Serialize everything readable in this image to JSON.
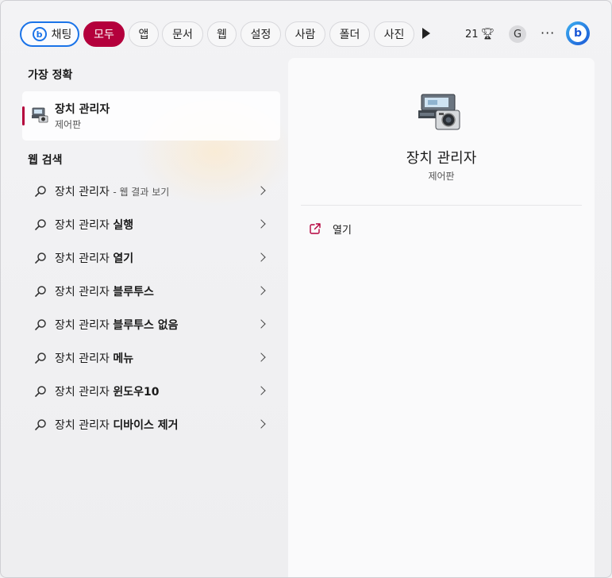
{
  "topbar": {
    "chat_label": "채팅",
    "chips": [
      "모두",
      "앱",
      "문서",
      "웹",
      "설정",
      "사람",
      "폴더",
      "사진"
    ],
    "active_chip": "모두",
    "points": "21",
    "avatar_letter": "G",
    "more": "···"
  },
  "best_match": {
    "section_title": "가장 정확",
    "title": "장치 관리자",
    "category": "제어판"
  },
  "web_search": {
    "section_title": "웹 검색",
    "results": [
      {
        "prefix": "장치 관리자",
        "bold": "",
        "suffix": "- 웹 결과 보기"
      },
      {
        "prefix": "장치 관리자 ",
        "bold": "실행",
        "suffix": ""
      },
      {
        "prefix": "장치 관리자 ",
        "bold": "열기",
        "suffix": ""
      },
      {
        "prefix": "장치 관리자 ",
        "bold": "블루투스",
        "suffix": ""
      },
      {
        "prefix": "장치 관리자 ",
        "bold": "블루투스 없음",
        "suffix": ""
      },
      {
        "prefix": "장치 관리자 ",
        "bold": "메뉴",
        "suffix": ""
      },
      {
        "prefix": "장치 관리자 ",
        "bold": "윈도우10",
        "suffix": ""
      },
      {
        "prefix": "장치 관리자 ",
        "bold": "디바이스 제거",
        "suffix": ""
      }
    ]
  },
  "detail": {
    "title": "장치 관리자",
    "category": "제어판",
    "actions": [
      {
        "label": "열기",
        "icon": "open-external-icon"
      }
    ]
  },
  "colors": {
    "accent": "#b4003c",
    "chat_border": "#1a73e8"
  }
}
